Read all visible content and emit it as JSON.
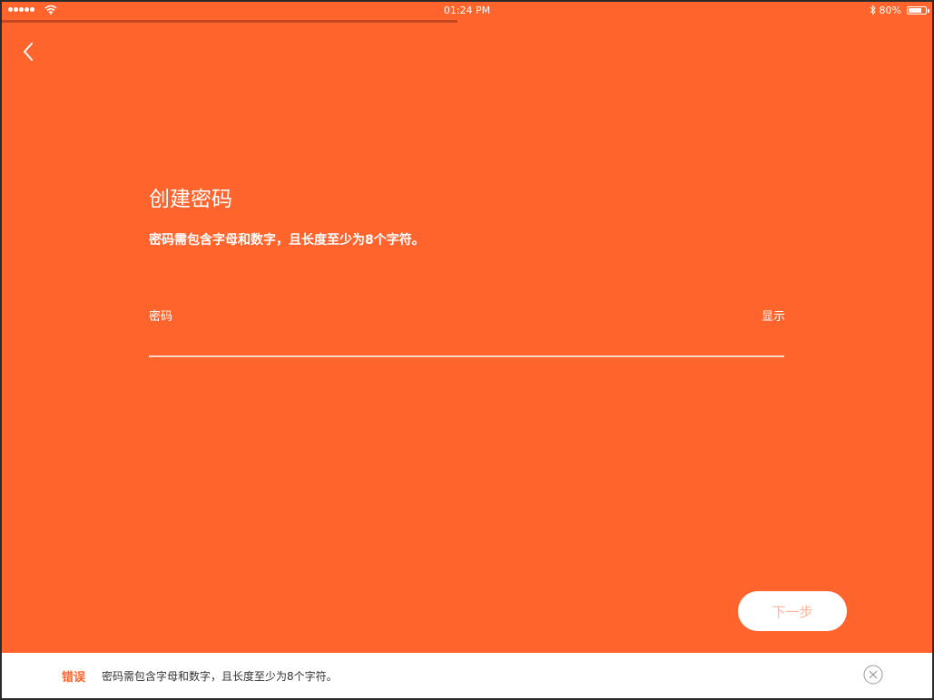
{
  "status_bar": {
    "time": "01:24 PM",
    "battery_text": "80%",
    "battery_level": 0.8,
    "icons": [
      "signal-dots-icon",
      "wifi-icon",
      "bluetooth-icon",
      "battery-icon"
    ]
  },
  "page_progress": 0.49,
  "nav": {
    "back_icon": "chevron-left-icon"
  },
  "header": {
    "title": "创建密码",
    "subtitle": "密码需包含字母和数字，且长度至少为8个字符。"
  },
  "password_field": {
    "label": "密码",
    "value": "",
    "show_label": "显示"
  },
  "next_button": {
    "label": "下一步"
  },
  "error_banner": {
    "label": "错误",
    "message": "密码需包含字母和数字，且长度至少为8个字符。",
    "close_icon": "close-circle-icon"
  },
  "colors": {
    "background": "#ff642d",
    "progress": "#c4471f",
    "accent_text": "#ff642d",
    "next_button_text": "#ffb396"
  }
}
